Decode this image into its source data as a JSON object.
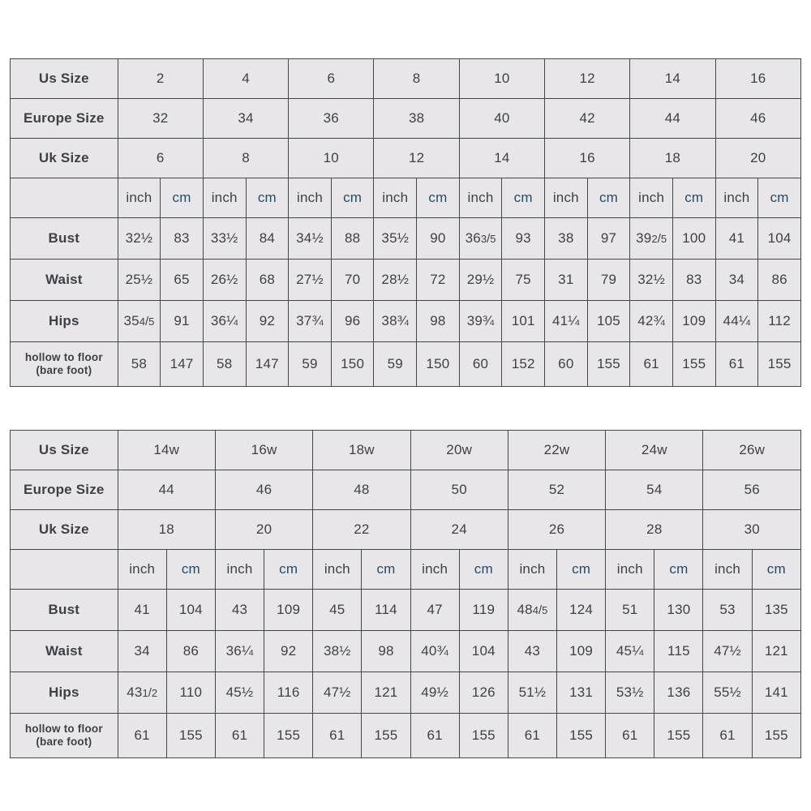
{
  "tables": [
    {
      "id": "standard-size-chart",
      "row_labels": {
        "us": "Us Size",
        "europe": "Europe Size",
        "uk": "Uk Size",
        "unit_blank": "",
        "bust": "Bust",
        "waist": "Waist",
        "hips": "Hips",
        "hollow_line1": "hollow to floor",
        "hollow_line2": "(bare foot)"
      },
      "units": {
        "inch": "inch",
        "cm": "cm"
      },
      "us_sizes": [
        "2",
        "4",
        "6",
        "8",
        "10",
        "12",
        "14",
        "16"
      ],
      "europe_sizes": [
        "32",
        "34",
        "36",
        "38",
        "40",
        "42",
        "44",
        "46"
      ],
      "uk_sizes": [
        "6",
        "8",
        "10",
        "12",
        "14",
        "16",
        "18",
        "20"
      ],
      "bust_inch": [
        "32½",
        "33½",
        "34½",
        "35½",
        "36 3/5",
        "38",
        "39 2/5",
        "41"
      ],
      "bust_cm": [
        "83",
        "84",
        "88",
        "90",
        "93",
        "97",
        "100",
        "104"
      ],
      "waist_inch": [
        "25½",
        "26½",
        "27½",
        "28½",
        "29½",
        "31",
        "32½",
        "34"
      ],
      "waist_cm": [
        "65",
        "68",
        "70",
        "72",
        "75",
        "79",
        "83",
        "86"
      ],
      "hips_inch": [
        "35 4/5",
        "36¼",
        "37¾",
        "38¾",
        "39¾",
        "41¼",
        "42¾",
        "44¼"
      ],
      "hips_cm": [
        "91",
        "92",
        "96",
        "98",
        "101",
        "105",
        "109",
        "112"
      ],
      "hollow_inch": [
        "58",
        "58",
        "59",
        "59",
        "60",
        "60",
        "61",
        "61"
      ],
      "hollow_cm": [
        "147",
        "147",
        "150",
        "150",
        "152",
        "155",
        "155",
        "155"
      ]
    },
    {
      "id": "plus-size-chart",
      "row_labels": {
        "us": "Us Size",
        "europe": "Europe Size",
        "uk": "Uk Size",
        "unit_blank": "",
        "bust": "Bust",
        "waist": "Waist",
        "hips": "Hips",
        "hollow_line1": "hollow to floor",
        "hollow_line2": "(bare foot)"
      },
      "units": {
        "inch": "inch",
        "cm": "cm"
      },
      "us_sizes": [
        "14w",
        "16w",
        "18w",
        "20w",
        "22w",
        "24w",
        "26w"
      ],
      "europe_sizes": [
        "44",
        "46",
        "48",
        "50",
        "52",
        "54",
        "56"
      ],
      "uk_sizes": [
        "18",
        "20",
        "22",
        "24",
        "26",
        "28",
        "30"
      ],
      "bust_inch": [
        "41",
        "43",
        "45",
        "47",
        "48 4/5",
        "51",
        "53"
      ],
      "bust_cm": [
        "104",
        "109",
        "114",
        "119",
        "124",
        "130",
        "135"
      ],
      "waist_inch": [
        "34",
        "36¼",
        "38½",
        "40¾",
        "43",
        "45¼",
        "47½"
      ],
      "waist_cm": [
        "86",
        "92",
        "98",
        "104",
        "109",
        "115",
        "121"
      ],
      "hips_inch": [
        "43 1/2",
        "45½",
        "47½",
        "49½",
        "51½",
        "53½",
        "55½"
      ],
      "hips_cm": [
        "110",
        "116",
        "121",
        "126",
        "131",
        "136",
        "141"
      ],
      "hollow_inch": [
        "61",
        "61",
        "61",
        "61",
        "61",
        "61",
        "61"
      ],
      "hollow_cm": [
        "155",
        "155",
        "155",
        "155",
        "155",
        "155",
        "155"
      ]
    }
  ],
  "colors": {
    "accent_blue": "#73cdf3",
    "cell_gray": "#e8e6e9",
    "border": "#43484f",
    "text": "#3c4148"
  }
}
